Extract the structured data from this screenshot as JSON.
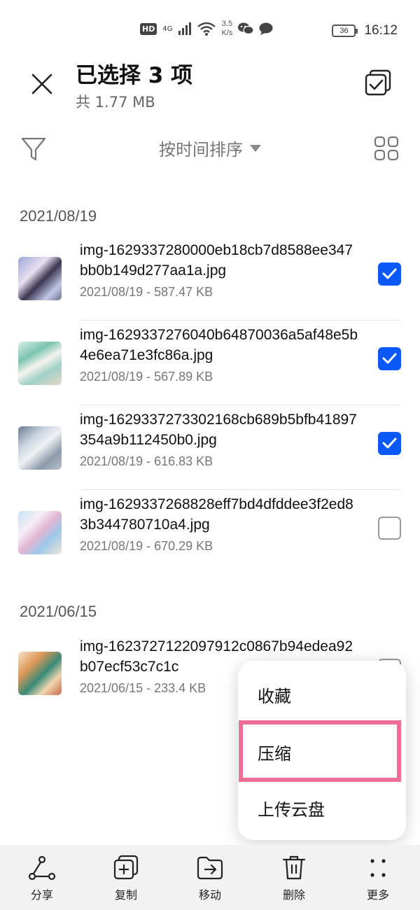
{
  "status_bar": {
    "hd": "HD",
    "network": "4G",
    "speed_value": "3.5",
    "speed_unit": "K/s",
    "battery": "36",
    "time": "16:12"
  },
  "header": {
    "title": "已选择 3 项",
    "subtitle": "共 1.77 MB"
  },
  "filter_bar": {
    "sort_label": "按时间排序"
  },
  "groups": [
    {
      "date": "2021/08/19",
      "files": [
        {
          "name": "img-1629337280000eb18cb7d8588ee347bb0b149d277aa1a.jpg",
          "meta": "2021/08/19 - 587.47 KB",
          "checked": true
        },
        {
          "name": "img-1629337276040b64870036a5af48e5b4e6ea71e3fc86a.jpg",
          "meta": "2021/08/19 - 567.89 KB",
          "checked": true
        },
        {
          "name": "img-1629337273302168cb689b5bfb41897354a9b112450b0.jpg",
          "meta": "2021/08/19 - 616.83 KB",
          "checked": true
        },
        {
          "name": "img-1629337268828eff7bd4dfddee3f2ed83b344780710a4.jpg",
          "meta": "2021/08/19 - 670.29 KB",
          "checked": false
        }
      ]
    },
    {
      "date": "2021/06/15",
      "files": [
        {
          "name": "img-1623727122097912c0867b94edea92b07ecf53c7c1c",
          "meta": "2021/06/15 - 233.4 KB",
          "checked": false
        }
      ]
    }
  ],
  "popup_menu": {
    "items": [
      "收藏",
      "压缩",
      "上传云盘"
    ]
  },
  "toolbar": {
    "share": "分享",
    "copy": "复制",
    "move": "移动",
    "delete": "删除",
    "more": "更多"
  },
  "colors": {
    "accent": "#0a59f7",
    "highlight": "#ee6f95"
  }
}
